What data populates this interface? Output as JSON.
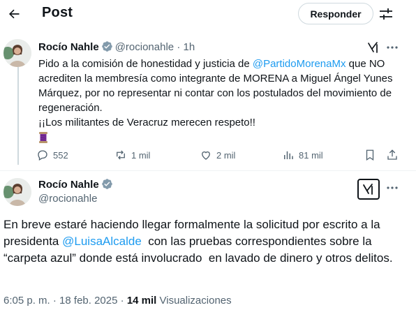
{
  "header": {
    "title": "Post",
    "reply_button": "Responder"
  },
  "tweet1": {
    "author_name": "Rocío Nahle",
    "author_handle": "@rocionahle",
    "separator": "·",
    "time": "1h",
    "text_part1": "Pido a la comisión de honestidad y justicia de ",
    "mention": "@PartidoMorenaMx",
    "text_part2": " que NO acrediten la membresía como integrante de MORENA a Miguel Ángel Yunes Márquez, por no representar ni contar con los postulados del movimiento de regeneración.",
    "text_line2": "¡¡Los militantes de Veracruz merecen respeto!!",
    "emoji": "spool-of-thread",
    "actions": {
      "replies": "552",
      "reposts": "1 mil",
      "likes": "2 mil",
      "views": "81 mil"
    }
  },
  "tweet2": {
    "author_name": "Rocío Nahle",
    "author_handle": "@rocionahle",
    "text_part1": "En breve estaré haciendo llegar formalmente la solicitud por escrito a la presidenta ",
    "mention": "@LuisaAlcalde",
    "text_part2": "  con las pruebas correspondientes sobre la “carpeta azul” donde está involucrado  en lavado de dinero y otros delitos.",
    "time": "6:05 p. m.",
    "separator": "·",
    "date": "18 feb. 2025",
    "views_count": "14 mil",
    "views_label": "Visualizaciones"
  },
  "icons": [
    "back-arrow-icon",
    "tune-icon",
    "verified-badge-icon",
    "grok-icon",
    "more-icon",
    "reply-icon",
    "repost-icon",
    "like-icon",
    "views-icon",
    "bookmark-icon",
    "share-icon"
  ],
  "colors": {
    "link": "#1d9bf0",
    "verified": "#829aab",
    "muted": "#536471",
    "text": "#0f1419"
  }
}
